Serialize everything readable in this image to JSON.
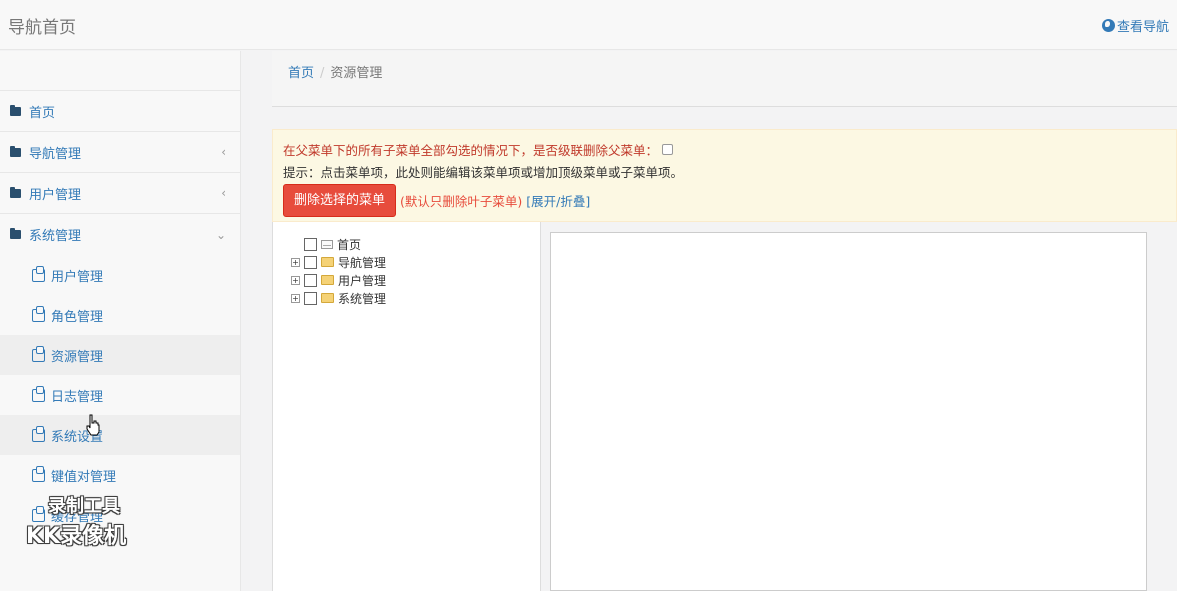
{
  "header": {
    "brand": "导航首页",
    "view_nav": "查看导航"
  },
  "sidebar": {
    "items": [
      {
        "label": "首页"
      },
      {
        "label": "导航管理",
        "caret": "‹"
      },
      {
        "label": "用户管理",
        "caret": "‹"
      },
      {
        "label": "系统管理",
        "caret": "⌄"
      }
    ],
    "sub_items": [
      {
        "label": "用户管理"
      },
      {
        "label": "角色管理"
      },
      {
        "label": "资源管理"
      },
      {
        "label": "日志管理"
      },
      {
        "label": "系统设置"
      },
      {
        "label": "键值对管理"
      },
      {
        "label": "缓存管理"
      }
    ]
  },
  "breadcrumb": {
    "home": "首页",
    "separator": "/",
    "current": "资源管理"
  },
  "alert": {
    "cascade_question": "在父菜单下的所有子菜单全部勾选的情况下，是否级联删除父菜单：",
    "hint": "提示：点击菜单项，此处则能编辑该菜单项或增加顶级菜单或子菜单项。",
    "delete_button": "删除选择的菜单",
    "default_note": "(默认只删除叶子菜单)",
    "toggle_open": "[展开/折叠]"
  },
  "tree": {
    "nodes": [
      {
        "label": "首页",
        "type": "leaf"
      },
      {
        "label": "导航管理",
        "type": "folder"
      },
      {
        "label": "用户管理",
        "type": "folder"
      },
      {
        "label": "系统管理",
        "type": "folder"
      }
    ]
  },
  "watermark": {
    "line1": "录制工具",
    "line2": "KK录像机"
  },
  "colors": {
    "link": "#337ab7",
    "danger": "#e74c3c",
    "alert_bg": "#fcf8e3"
  }
}
